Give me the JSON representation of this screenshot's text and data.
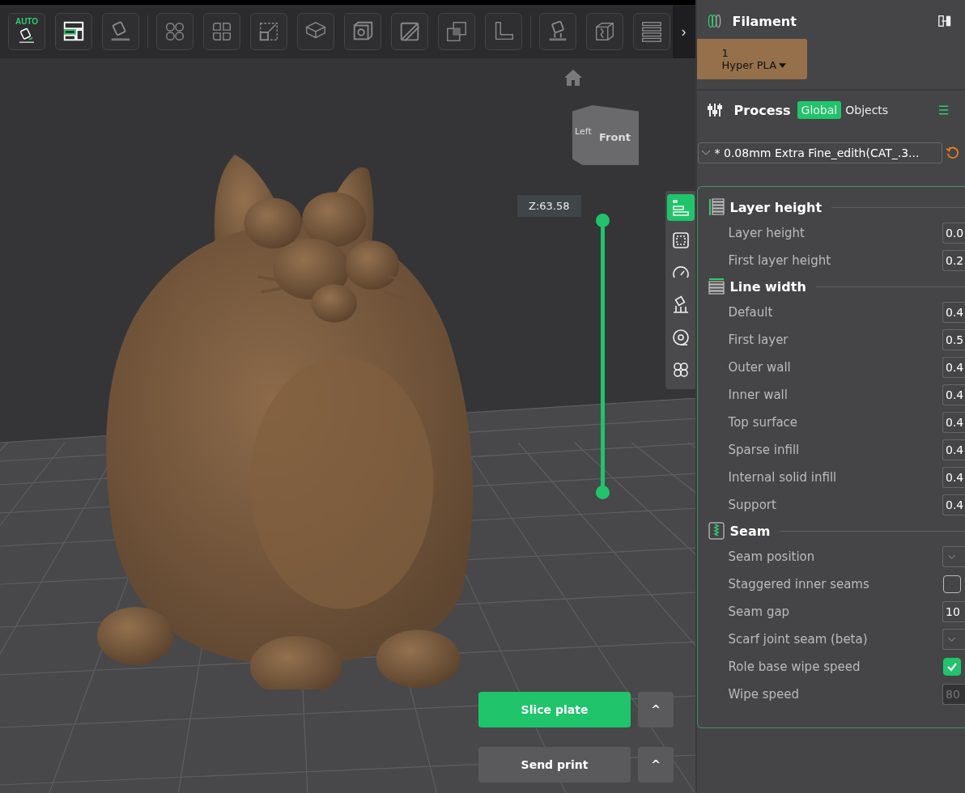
{
  "toolbar": {
    "items": [
      {
        "kind": "auto-orient",
        "label": "AUTO"
      },
      {
        "kind": "arrange"
      },
      {
        "kind": "orient"
      },
      {
        "kind": "split-objects"
      },
      {
        "kind": "split-parts"
      },
      {
        "kind": "scale"
      },
      {
        "kind": "cut"
      },
      {
        "kind": "hollow"
      },
      {
        "kind": "slash"
      },
      {
        "kind": "boolean"
      },
      {
        "kind": "measure"
      },
      {
        "kind": "supports"
      },
      {
        "kind": "seam"
      },
      {
        "kind": "layers"
      }
    ],
    "more": "›"
  },
  "viewport": {
    "nav_cube": {
      "left": "Left",
      "front": "Front"
    },
    "layer_slider": {
      "label": "Z:63.58",
      "level": 1
    },
    "view_tools": [
      {
        "kind": "layers",
        "selected": true
      },
      {
        "kind": "frame",
        "selected": false
      },
      {
        "kind": "gauge",
        "selected": false
      },
      {
        "kind": "support",
        "selected": false
      },
      {
        "kind": "target",
        "selected": false
      },
      {
        "kind": "clover",
        "selected": false
      }
    ],
    "actions": [
      {
        "label": "Slice plate",
        "primary": true,
        "menu": "^"
      },
      {
        "label": "Send print",
        "primary": false,
        "menu": "^"
      }
    ]
  },
  "sidebar": {
    "filament": {
      "title": "Filament",
      "slots": [
        {
          "number": "1",
          "name": "Hyper PLA",
          "color": "#95704b"
        }
      ]
    },
    "process": {
      "title": "Process",
      "tabs": [
        {
          "label": "Global",
          "selected": true
        },
        {
          "label": "Objects",
          "selected": false
        }
      ],
      "preset": "* 0.08mm Extra Fine_edith(CAT_.3..."
    },
    "sections": [
      {
        "title": "Layer height",
        "kind": "layers",
        "rows": [
          {
            "label": "Layer height",
            "kind": "number",
            "value": "0.0"
          },
          {
            "label": "First layer height",
            "kind": "number",
            "value": "0.2"
          }
        ]
      },
      {
        "title": "Line width",
        "kind": "lines",
        "rows": [
          {
            "label": "Default",
            "kind": "number",
            "value": "0.4"
          },
          {
            "label": "First layer",
            "kind": "number",
            "value": "0.5"
          },
          {
            "label": "Outer wall",
            "kind": "number",
            "value": "0.4"
          },
          {
            "label": "Inner wall",
            "kind": "number",
            "value": "0.4"
          },
          {
            "label": "Top surface",
            "kind": "number",
            "value": "0.4"
          },
          {
            "label": "Sparse infill",
            "kind": "number",
            "value": "0.4"
          },
          {
            "label": "Internal solid infill",
            "kind": "number",
            "value": "0.4"
          },
          {
            "label": "Support",
            "kind": "number",
            "value": "0.4"
          }
        ]
      },
      {
        "title": "Seam",
        "kind": "seam",
        "rows": [
          {
            "label": "Seam position",
            "kind": "dropdown"
          },
          {
            "label": "Staggered inner seams",
            "kind": "checkbox",
            "checked": false
          },
          {
            "label": "Seam gap",
            "kind": "number",
            "value": "10"
          },
          {
            "label": "Scarf joint seam (beta)",
            "kind": "dropdown"
          },
          {
            "label": "Role base wipe speed",
            "kind": "checkbox",
            "checked": true
          },
          {
            "label": "Wipe speed",
            "kind": "number",
            "value": "80",
            "disabled": true
          }
        ]
      }
    ]
  }
}
